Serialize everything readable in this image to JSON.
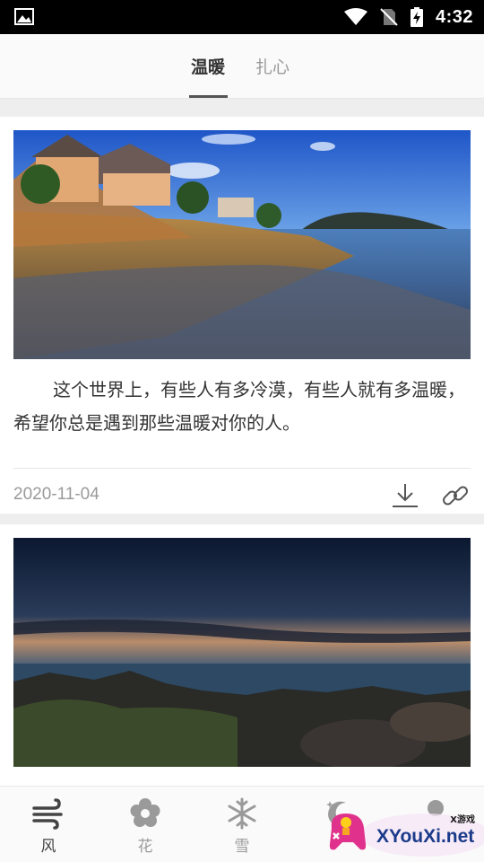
{
  "status_bar": {
    "time": "4:32",
    "icons": [
      "image-icon",
      "wifi-icon",
      "no-sim-icon",
      "battery-charging-icon"
    ]
  },
  "tabs": [
    {
      "label": "温暖",
      "active": true
    },
    {
      "label": "扎心",
      "active": false
    }
  ],
  "feed": [
    {
      "image": "seaside-houses-beach-photo",
      "quote": "这个世界上，有些人有多冷漠，有些人就有多温暖，希望你总是遇到那些温暖对你的人。",
      "date": "2020-11-04",
      "actions": [
        "download-icon",
        "link-icon"
      ]
    },
    {
      "image": "rocky-coast-dusk-photo"
    }
  ],
  "bottom_nav": [
    {
      "label": "风",
      "icon": "wind-icon",
      "active": true
    },
    {
      "label": "花",
      "icon": "flower-icon",
      "active": false
    },
    {
      "label": "雪",
      "icon": "snowflake-icon",
      "active": false
    },
    {
      "label": "",
      "icon": "moon-stars-icon",
      "active": false
    },
    {
      "label": "",
      "icon": "profile-icon",
      "active": false
    }
  ],
  "watermark": {
    "logo_text": "XYouXi.net",
    "small_text": "X游戏"
  },
  "colors": {
    "status_bar": "#000000",
    "background": "#eeeeee",
    "text_primary": "#333333",
    "text_secondary": "#9a9a9a"
  }
}
